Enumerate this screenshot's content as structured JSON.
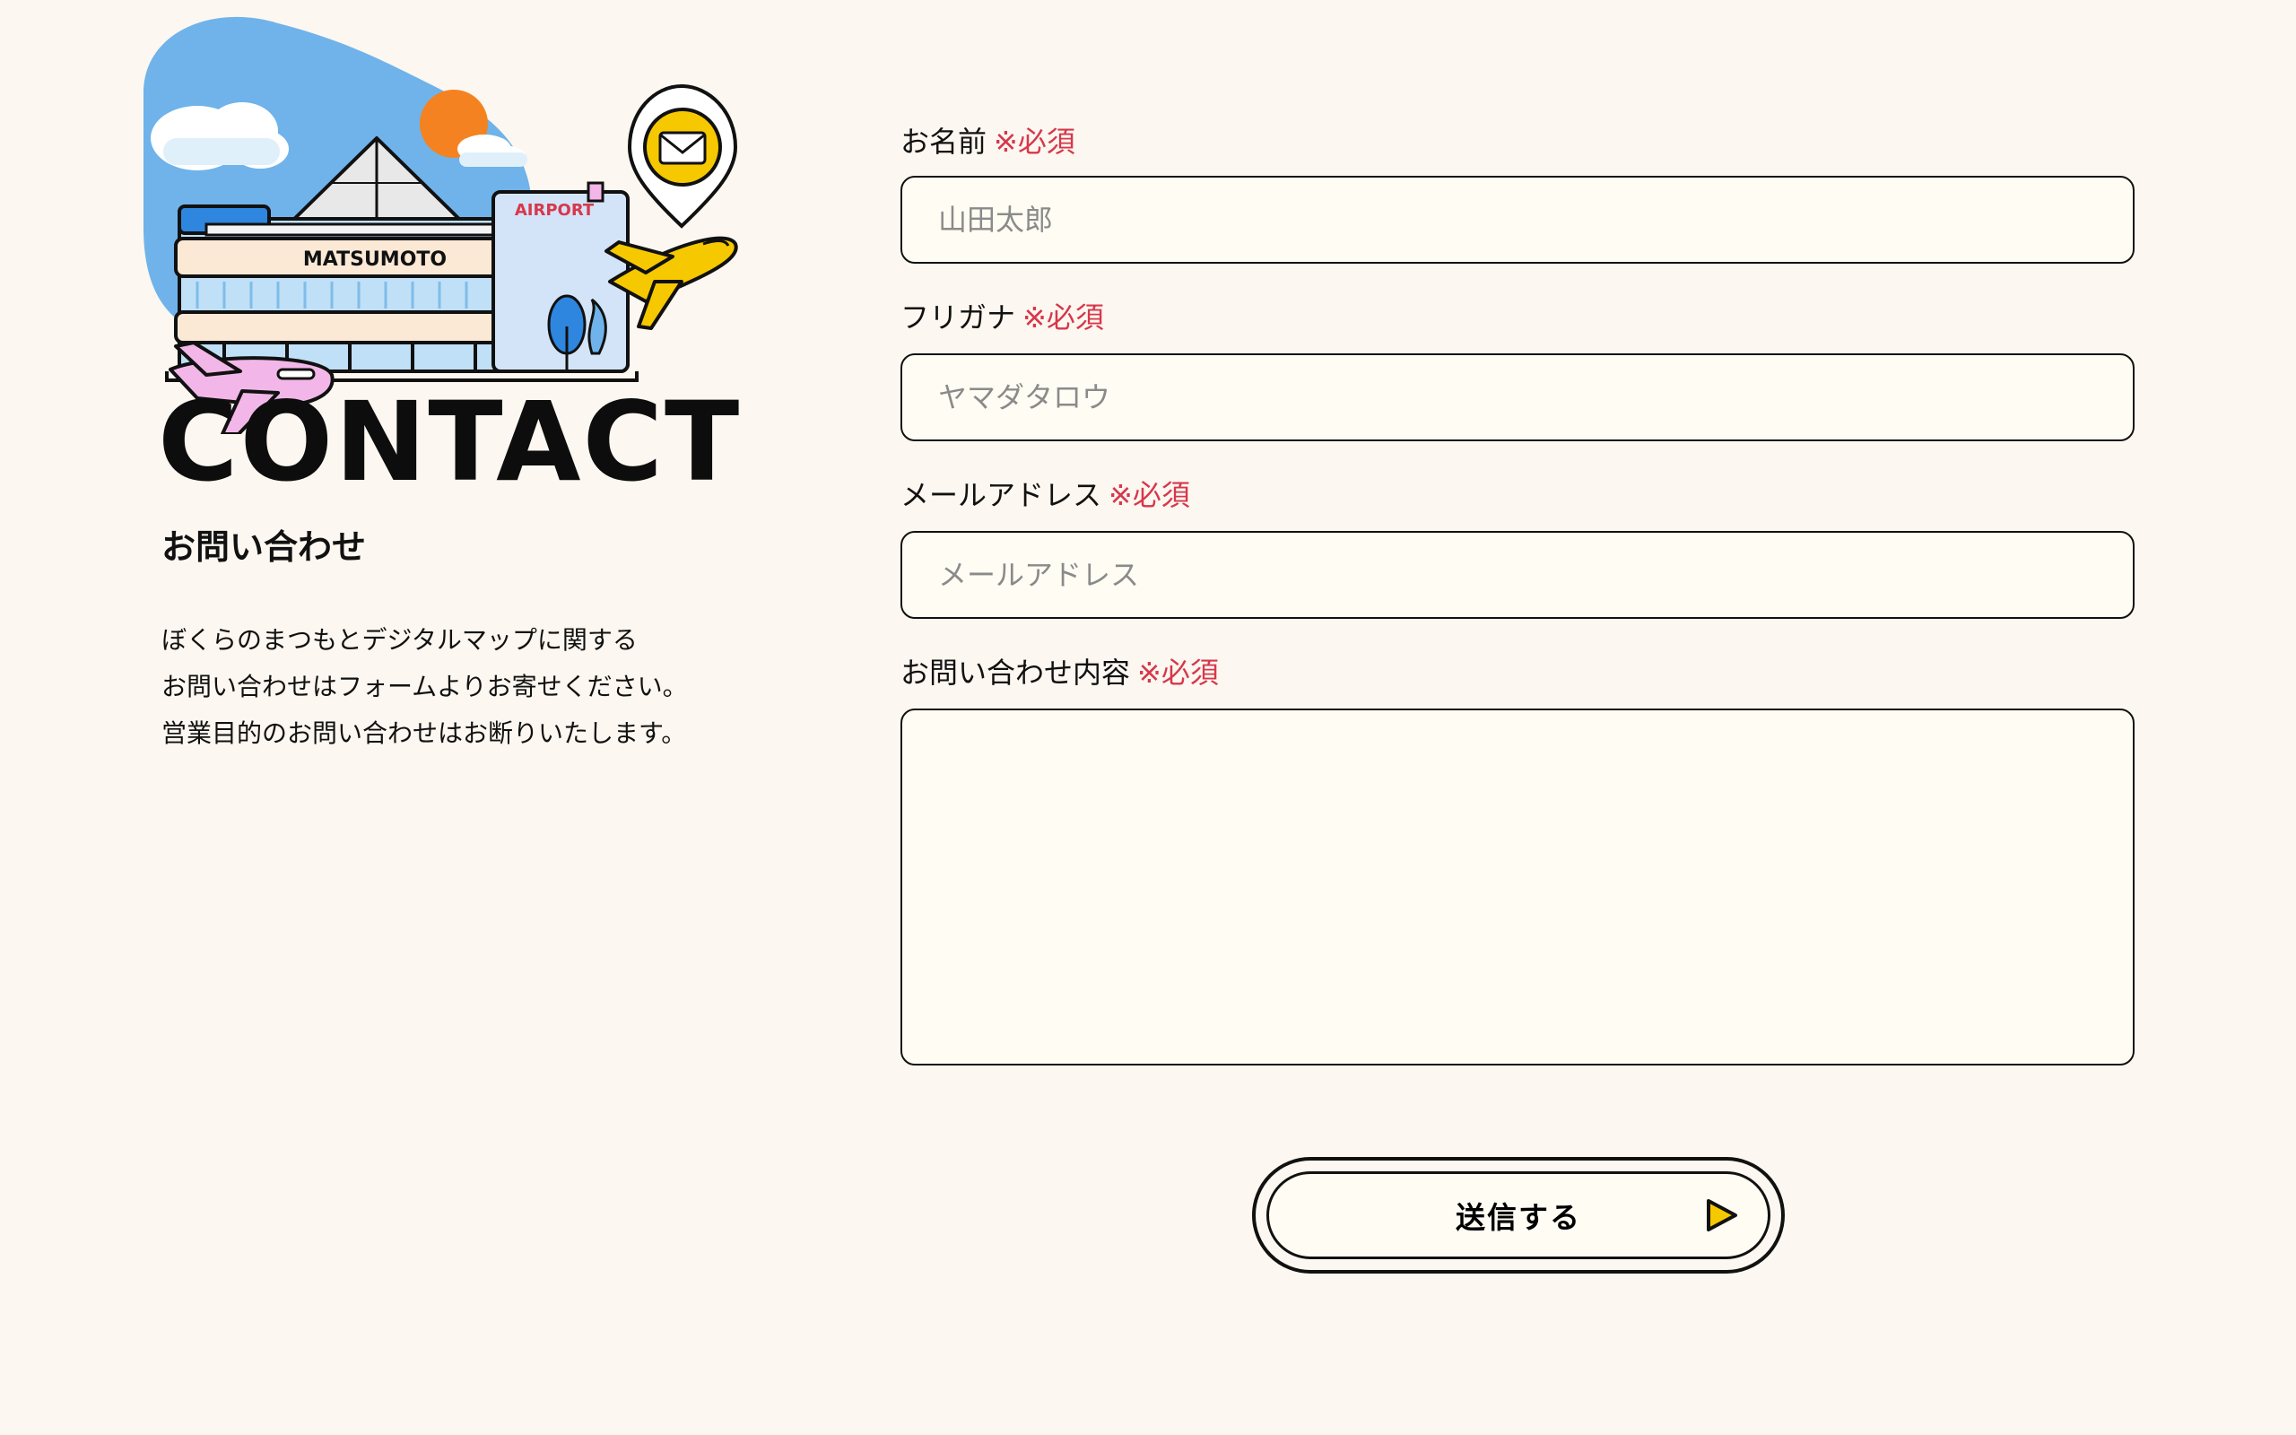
{
  "left": {
    "illustration": {
      "building_sign": "MATSUMOTO",
      "airport_sign": "AIRPORT"
    },
    "heading": "CONTACT",
    "subheading": "お問い合わせ",
    "intro_lines": [
      "ぼくらのまつもとデジタルマップに関する",
      "お問い合わせはフォームよりお寄せください。",
      "営業目的のお問い合わせはお断りいたします。"
    ]
  },
  "form": {
    "required_mark": "※必須",
    "name": {
      "label": "お名前",
      "placeholder": "山田太郎"
    },
    "furigana": {
      "label": "フリガナ",
      "placeholder": "ヤマダタロウ"
    },
    "email": {
      "label": "メールアドレス",
      "placeholder": "メールアドレス"
    },
    "message": {
      "label": "お問い合わせ内容",
      "placeholder": ""
    },
    "submit_label": "送信する"
  },
  "colors": {
    "background": "#fcf7f0",
    "field_background": "#fffcf3",
    "required": "#d7374b",
    "accent_yellow": "#f6c800",
    "sky_blue": "#6fb3ea",
    "sun_orange": "#f58220",
    "plane_pink": "#f2b7e8"
  },
  "icons": {
    "mail_pin": "mail-pin-icon",
    "submit_arrow": "play-arrow-icon"
  }
}
